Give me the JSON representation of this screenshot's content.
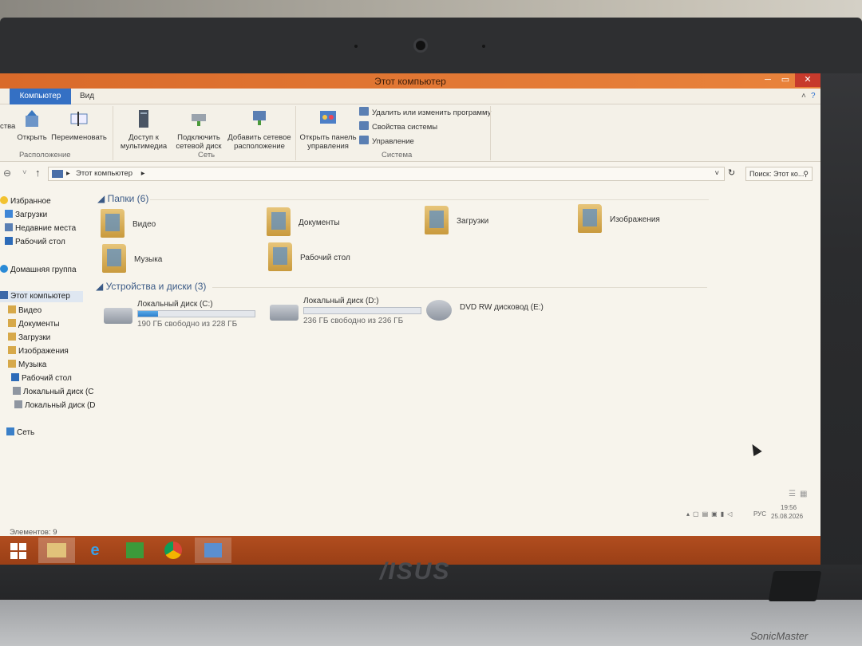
{
  "window": {
    "title": "Этот компьютер",
    "minimize": "─",
    "maximize": "▭",
    "close": "✕"
  },
  "ribbon_tabs": {
    "active": "Компьютер",
    "view": "Вид"
  },
  "ribbon": {
    "partial_btn": "ства",
    "open": "Открыть",
    "rename": "Переименовать",
    "media_access": "Доступ к мультимедиа",
    "map_drive": "Подключить сетевой диск",
    "add_location": "Добавить сетевое расположение",
    "control_panel": "Открыть панель управления",
    "uninstall": "Удалить или изменить программу",
    "system_props": "Свойства системы",
    "manage": "Управление",
    "group_location": "Расположение",
    "group_network": "Сеть",
    "group_system": "Система"
  },
  "address": {
    "path": "Этот компьютер",
    "search_placeholder": "Поиск: Этот ко..."
  },
  "nav": {
    "favorites": "Избранное",
    "downloads": "Загрузки",
    "recent": "Недавние места",
    "desktop": "Рабочий стол",
    "homegroup": "Домашняя группа",
    "this_pc": "Этот компьютер",
    "video": "Видео",
    "documents": "Документы",
    "downloads2": "Загрузки",
    "images": "Изображения",
    "music": "Музыка",
    "desktop2": "Рабочий стол",
    "disk_c": "Локальный диск (C",
    "disk_d": "Локальный диск (D",
    "network": "Сеть"
  },
  "sections": {
    "folders": "Папки (6)",
    "devices": "Устройства и диски (3)"
  },
  "folders": [
    "Видео",
    "Документы",
    "Загрузки",
    "Изображения",
    "Музыка",
    "Рабочий стол"
  ],
  "drives": [
    {
      "name": "Локальный диск (C:)",
      "free": "190 ГБ свободно из 228 ГБ",
      "used_fraction": 0.17
    },
    {
      "name": "Локальный диск (D:)",
      "free": "236 ГБ свободно из 236 ГБ",
      "used_fraction": 0.0
    },
    {
      "name": "DVD RW дисковод (E:)"
    }
  ],
  "status": {
    "items": "Элементов: 9"
  },
  "tray": {
    "lang": "РУС",
    "time": "19:56",
    "date": "25.08.2026"
  },
  "brand": {
    "logo": "/ISUS",
    "sonic": "SonicMaster"
  }
}
